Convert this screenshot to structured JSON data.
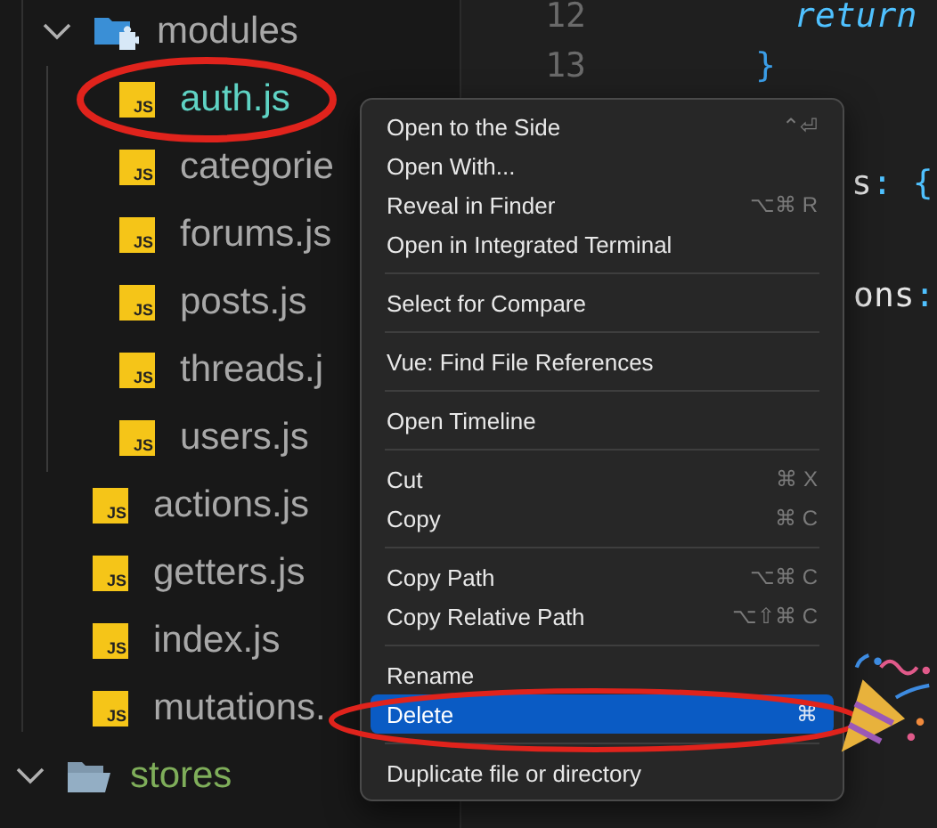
{
  "explorer": {
    "items": [
      {
        "kind": "folder",
        "name": "modules",
        "expanded": true,
        "color": "#a8a8a8",
        "children": [
          {
            "kind": "file",
            "name": "auth.js",
            "badge": "JS",
            "color": "#5fd3c4"
          },
          {
            "kind": "file",
            "name": "categorie",
            "badge": "JS",
            "color": "#a8a8a8"
          },
          {
            "kind": "file",
            "name": "forums.js",
            "badge": "JS",
            "color": "#a8a8a8"
          },
          {
            "kind": "file",
            "name": "posts.js",
            "badge": "JS",
            "color": "#a8a8a8"
          },
          {
            "kind": "file",
            "name": "threads.j",
            "badge": "JS",
            "color": "#a8a8a8"
          },
          {
            "kind": "file",
            "name": "users.js",
            "badge": "JS",
            "color": "#a8a8a8"
          }
        ]
      },
      {
        "kind": "file",
        "name": "actions.js",
        "badge": "JS",
        "color": "#a8a8a8"
      },
      {
        "kind": "file",
        "name": "getters.js",
        "badge": "JS",
        "color": "#a8a8a8"
      },
      {
        "kind": "file",
        "name": "index.js",
        "badge": "JS",
        "color": "#a8a8a8"
      },
      {
        "kind": "file",
        "name": "mutations.",
        "badge": "JS",
        "color": "#a8a8a8"
      }
    ],
    "outer_items": [
      {
        "kind": "folder",
        "name": "stores",
        "expanded": true,
        "color": "#7fae5a"
      }
    ]
  },
  "editor": {
    "lines": [
      {
        "number": "12",
        "tokens": [
          {
            "text": "return",
            "kind": "keyword"
          }
        ]
      },
      {
        "number": "13",
        "tokens": [
          {
            "text": "}",
            "kind": "brace"
          }
        ]
      },
      {
        "tokens": [
          {
            "text": "s",
            "kind": "prop"
          },
          {
            "text": ": {",
            "kind": "punct"
          }
        ]
      },
      {
        "tokens": [
          {
            "text": "ons",
            "kind": "prop"
          },
          {
            "text": ":",
            "kind": "punct"
          }
        ]
      }
    ]
  },
  "context_menu": {
    "groups": [
      [
        {
          "label": "Open to the Side",
          "shortcut": "⌃⏎",
          "selected": false
        },
        {
          "label": "Open With...",
          "selected": false
        },
        {
          "label": "Reveal in Finder",
          "shortcut": "⌥⌘ R",
          "selected": false
        },
        {
          "label": "Open in Integrated Terminal",
          "selected": false
        }
      ],
      [
        {
          "label": "Select for Compare",
          "selected": false
        }
      ],
      [
        {
          "label": "Vue: Find File References",
          "selected": false
        }
      ],
      [
        {
          "label": "Open Timeline",
          "selected": false
        }
      ],
      [
        {
          "label": "Cut",
          "shortcut": "⌘ X",
          "selected": false
        },
        {
          "label": "Copy",
          "shortcut": "⌘ C",
          "selected": false
        }
      ],
      [
        {
          "label": "Copy Path",
          "shortcut": "⌥⌘ C",
          "selected": false
        },
        {
          "label": "Copy Relative Path",
          "shortcut": "⌥⇧⌘ C",
          "selected": false
        }
      ],
      [
        {
          "label": "Rename",
          "selected": false
        },
        {
          "label": "Delete",
          "shortcut": "⌘",
          "selected": true
        }
      ],
      [
        {
          "label": "Duplicate file or directory",
          "selected": false
        }
      ]
    ]
  }
}
